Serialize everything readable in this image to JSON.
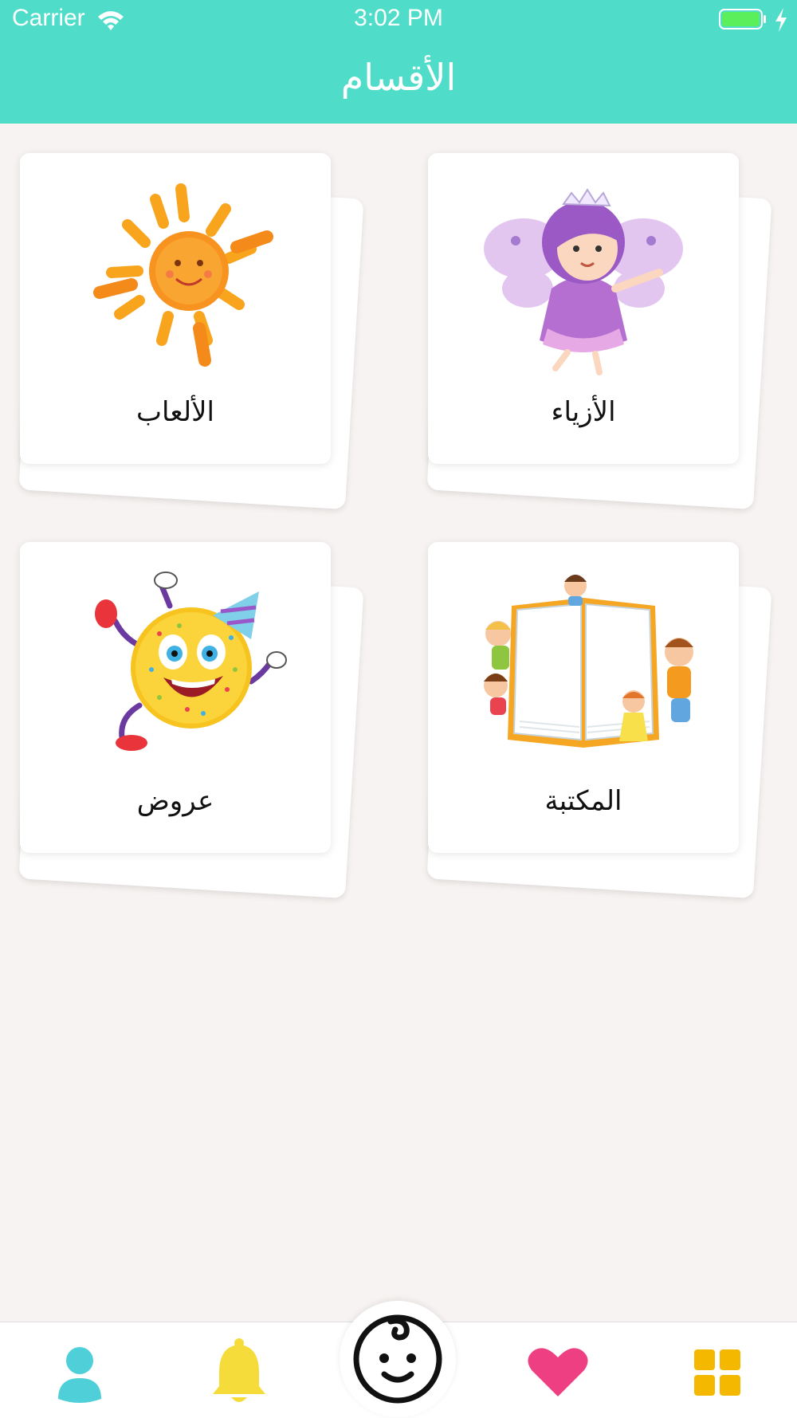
{
  "status_bar": {
    "carrier": "Carrier",
    "time": "3:02 PM"
  },
  "header": {
    "title": "الأقسام"
  },
  "categories": [
    {
      "label": "الأزياء",
      "icon": "fairy-illustration"
    },
    {
      "label": "الألعاب",
      "icon": "sun-illustration"
    },
    {
      "label": "المكتبة",
      "icon": "book-with-kids-illustration"
    },
    {
      "label": "عروض",
      "icon": "party-smiley-balloon-illustration"
    }
  ],
  "tab_bar": {
    "items": [
      {
        "icon": "grid-icon",
        "color": "#f5b800"
      },
      {
        "icon": "heart-icon",
        "color": "#ee3f82"
      },
      {
        "icon": "baby-face-icon",
        "color": "#111111"
      },
      {
        "icon": "bell-icon",
        "color": "#f6dc3a"
      },
      {
        "icon": "profile-icon",
        "color": "#4fcfd8"
      }
    ]
  },
  "colors": {
    "header": "#4fddc9",
    "background": "#f7f3f2"
  }
}
